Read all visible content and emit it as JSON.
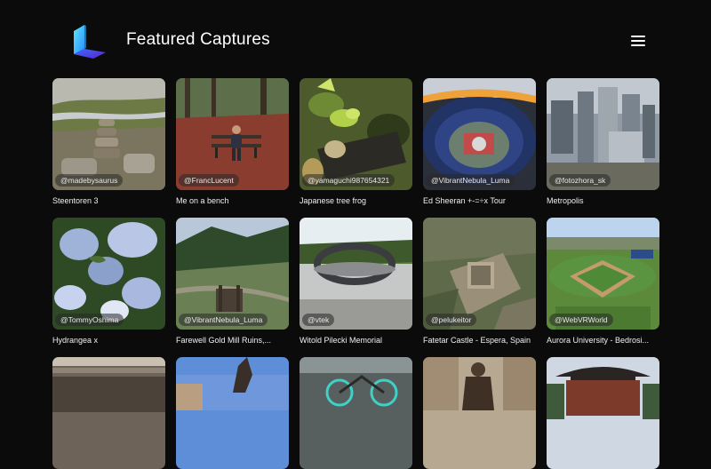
{
  "app": {
    "title": "Featured Captures",
    "logo_icon": "cube-logo-icon",
    "menu_icon": "hamburger-menu-icon"
  },
  "colors": {
    "background": "#0b0b0c",
    "text": "#ffffff",
    "logo_light": "#3fd0ff",
    "logo_dark": "#4a2bd8"
  },
  "captures": [
    {
      "title": "Steentoren 3",
      "handle": "@madebysaurus"
    },
    {
      "title": "Me on a bench",
      "handle": "@FrancLucent"
    },
    {
      "title": "Japanese tree frog",
      "handle": "@yamaguchi987654321"
    },
    {
      "title": "Ed Sheeran +-=÷x Tour",
      "handle": "@VibrantNebula_Luma"
    },
    {
      "title": "Metropolis",
      "handle": "@fotozhora_sk"
    },
    {
      "title": "Hydrangea x",
      "handle": "@TommyOshima"
    },
    {
      "title": "Farewell Gold Mill Ruins,...",
      "handle": "@VibrantNebula_Luma"
    },
    {
      "title": "Witold Pilecki Memorial",
      "handle": "@vtek"
    },
    {
      "title": "Fatetar Castle - Espera, Spain",
      "handle": "@pelukeitor"
    },
    {
      "title": "Aurora University - Bedrosi...",
      "handle": "@WebVRWorld"
    },
    {
      "title": "",
      "handle": ""
    },
    {
      "title": "",
      "handle": ""
    },
    {
      "title": "",
      "handle": ""
    },
    {
      "title": "",
      "handle": ""
    },
    {
      "title": "",
      "handle": ""
    }
  ]
}
